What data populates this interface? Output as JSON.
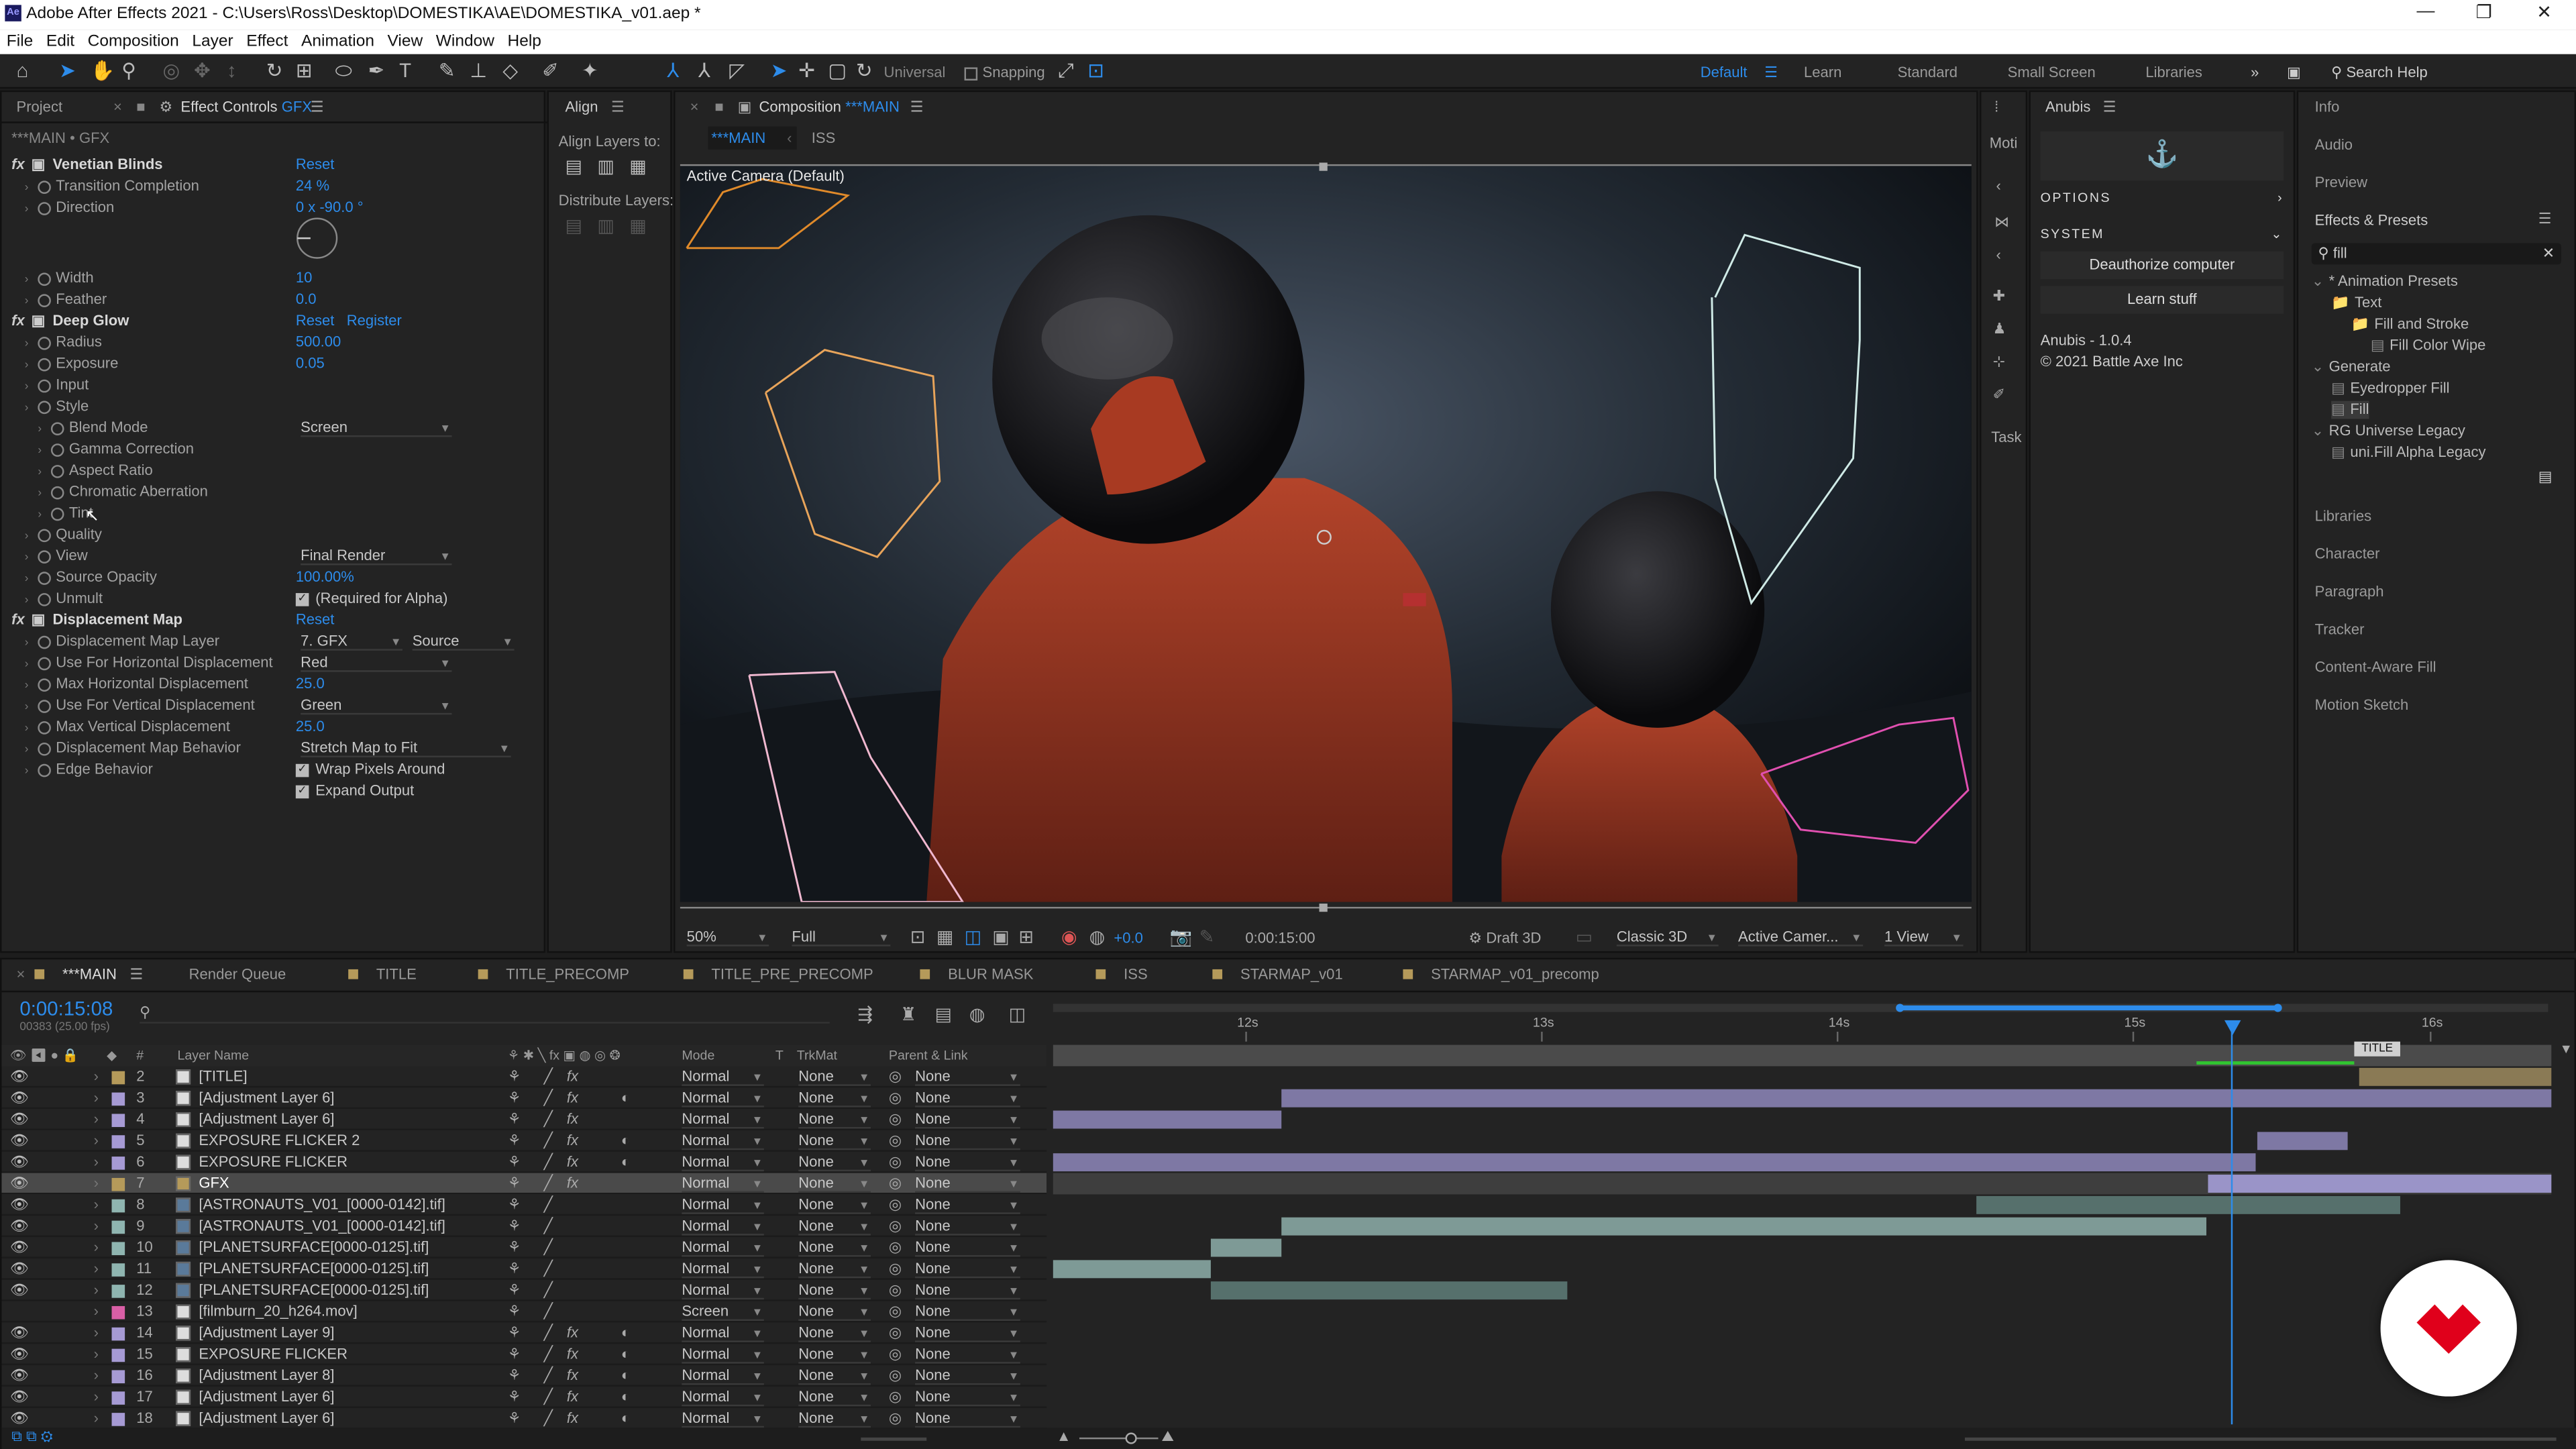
{
  "window": {
    "title": "Adobe After Effects 2021 - C:\\Users\\Ross\\Desktop\\DOMESTIKA\\AE\\DOMESTIKA_v01.aep *",
    "minimize": "—",
    "maximize": "❐",
    "close": "✕"
  },
  "menu": [
    "File",
    "Edit",
    "Composition",
    "Layer",
    "Effect",
    "Animation",
    "View",
    "Window",
    "Help"
  ],
  "toolbar": {
    "universal": "Universal",
    "snapping": "Snapping"
  },
  "workspaces": {
    "default": "Default",
    "learn": "Learn",
    "standard": "Standard",
    "small_screen": "Small Screen",
    "libraries": "Libraries",
    "search": "Search Help"
  },
  "left_panel": {
    "tab_project": "Project",
    "tab_effect_controls": "Effect Controls",
    "tab_layer": "GFX",
    "context": "***MAIN • GFX",
    "rows": [
      {
        "label": "Venetian Blinds",
        "value": "Reset",
        "bold": true,
        "fx": true
      },
      {
        "label": "Transition Completion",
        "value": "24 %"
      },
      {
        "label": "Direction",
        "value": "0 x -90.0 °"
      },
      {
        "label": "Width",
        "value": "10"
      },
      {
        "label": "Feather",
        "value": "0.0"
      },
      {
        "label": "Deep Glow",
        "value": "Reset",
        "extra": "Register",
        "bold": true,
        "fx": true
      },
      {
        "label": "Radius",
        "value": "500.00"
      },
      {
        "label": "Exposure",
        "value": "0.05"
      },
      {
        "label": "Input",
        "value": ""
      },
      {
        "label": "Style",
        "value": ""
      },
      {
        "label": "Blend Mode",
        "value": "Screen",
        "dropdown": true
      },
      {
        "label": "Gamma Correction",
        "value": ""
      },
      {
        "label": "Aspect Ratio",
        "value": ""
      },
      {
        "label": "Chromatic Aberration",
        "value": ""
      },
      {
        "label": "Tint",
        "value": ""
      },
      {
        "label": "Quality",
        "value": ""
      },
      {
        "label": "View",
        "value": "Final Render",
        "dropdown": true
      },
      {
        "label": "Source Opacity",
        "value": "100.00%"
      },
      {
        "label": "Unmult",
        "value": "(Required for Alpha)",
        "checkbox": true
      },
      {
        "label": "Displacement Map",
        "value": "Reset",
        "bold": true,
        "fx": true
      },
      {
        "label": "Displacement Map Layer",
        "value": "7. GFX",
        "value2": "Source",
        "dropdown": true
      },
      {
        "label": "Use For Horizontal Displacement",
        "value": "Red",
        "dropdown": true
      },
      {
        "label": "Max Horizontal Displacement",
        "value": "25.0"
      },
      {
        "label": "Use For Vertical Displacement",
        "value": "Green",
        "dropdown": true
      },
      {
        "label": "Max Vertical Displacement",
        "value": "25.0"
      },
      {
        "label": "Displacement Map Behavior",
        "value": "Stretch Map to Fit",
        "dropdown": true
      },
      {
        "label": "Edge Behavior",
        "value": "Wrap Pixels Around",
        "checkbox": true
      },
      {
        "label": "",
        "value": "Expand Output",
        "checkbox": true
      }
    ]
  },
  "align_panel": {
    "title": "Align",
    "align_to": "Align Layers to:",
    "distribute": "Distribute Layers:"
  },
  "comp_panel": {
    "title": "Composition",
    "comp_name": "***MAIN",
    "tab_main": "***MAIN",
    "tab_iss": "ISS",
    "camera": "Active Camera (Default)",
    "footer": {
      "zoom": "50%",
      "resolution": "Full",
      "exposure": "+0.0",
      "timecode": "0:00:15:00",
      "draft": "Draft 3D",
      "renderer": "Classic 3D",
      "camera": "Active Camer...",
      "views": "1 View"
    }
  },
  "side_tabs": [
    "Moti",
    "Task"
  ],
  "anubis": {
    "title": "Anubis",
    "options": "OPTIONS",
    "system": "SYSTEM",
    "deauth": "Deauthorize computer",
    "learn": "Learn stuff",
    "version": "Anubis - 1.0.4",
    "copyright": "© 2021 Battle Axe Inc"
  },
  "right_panel": {
    "top_items": [
      "Info",
      "Audio",
      "Preview",
      "Effects & Presets"
    ],
    "search": "fill",
    "tree": [
      {
        "label": "* Animation Presets",
        "level": 0
      },
      {
        "label": "Text",
        "level": 1
      },
      {
        "label": "Fill and Stroke",
        "level": 2
      },
      {
        "label": "Fill Color Wipe",
        "level": 3
      },
      {
        "label": "Generate",
        "level": 0
      },
      {
        "label": "Eyedropper Fill",
        "level": 1
      },
      {
        "label": "Fill",
        "level": 1,
        "selected": true
      },
      {
        "label": "RG Universe Legacy",
        "level": 0
      },
      {
        "label": "uni.Fill Alpha Legacy",
        "level": 1
      }
    ],
    "bottom_items": [
      "Libraries",
      "Character",
      "Paragraph",
      "Tracker",
      "Content-Aware Fill",
      "Motion Sketch"
    ]
  },
  "timeline": {
    "tabs": [
      "***MAIN",
      "Render Queue",
      "TITLE",
      "TITLE_PRECOMP",
      "TITLE_PRE_PRECOMP",
      "BLUR MASK",
      "ISS",
      "STARMAP_v01",
      "STARMAP_v01_precomp"
    ],
    "timecode": "0:00:15:08",
    "frames": "00383 (25.00 fps)",
    "headers": {
      "layer_name": "Layer Name",
      "mode": "Mode",
      "t": "T",
      "trkmat": "TrkMat",
      "parent": "Parent & Link",
      "hash": "#"
    },
    "ruler": [
      "12s",
      "13s",
      "14s",
      "15s",
      "16s"
    ],
    "title_marker": "TITLE",
    "layers": [
      {
        "num": "2",
        "name": "[TITLE]",
        "color": "#b59a5a",
        "mode": "Normal",
        "trk": "None",
        "parent": "None"
      },
      {
        "num": "3",
        "name": "[Adjustment Layer 6]",
        "color": "#a69ad4",
        "mode": "Normal",
        "trk": "None",
        "parent": "None"
      },
      {
        "num": "4",
        "name": "[Adjustment Layer 6]",
        "color": "#a69ad4",
        "mode": "Normal",
        "trk": "None",
        "parent": "None"
      },
      {
        "num": "5",
        "name": "EXPOSURE FLICKER 2",
        "color": "#a69ad4",
        "mode": "Normal",
        "trk": "None",
        "parent": "None"
      },
      {
        "num": "6",
        "name": "EXPOSURE FLICKER",
        "color": "#a69ad4",
        "mode": "Normal",
        "trk": "None",
        "parent": "None"
      },
      {
        "num": "7",
        "name": "GFX",
        "color": "#b59a5a",
        "mode": "Normal",
        "trk": "None",
        "parent": "None",
        "selected": true
      },
      {
        "num": "8",
        "name": "[ASTRONAUTS_V01_[0000-0142].tif]",
        "color": "#8fb5b0",
        "mode": "Normal",
        "trk": "None",
        "parent": "None"
      },
      {
        "num": "9",
        "name": "[ASTRONAUTS_V01_[0000-0142].tif]",
        "color": "#8fb5b0",
        "mode": "Normal",
        "trk": "None",
        "parent": "None"
      },
      {
        "num": "10",
        "name": "[PLANETSURFACE[0000-0125].tif]",
        "color": "#8fb5b0",
        "mode": "Normal",
        "trk": "None",
        "parent": "None"
      },
      {
        "num": "11",
        "name": "[PLANETSURFACE[0000-0125].tif]",
        "color": "#8fb5b0",
        "mode": "Normal",
        "trk": "None",
        "parent": "None"
      },
      {
        "num": "12",
        "name": "[PLANETSURFACE[0000-0125].tif]",
        "color": "#8fb5b0",
        "mode": "Normal",
        "trk": "None",
        "parent": "None"
      },
      {
        "num": "13",
        "name": "[filmburn_20_h264.mov]",
        "color": "#d95fa6",
        "mode": "Screen",
        "trk": "None",
        "parent": "None"
      },
      {
        "num": "14",
        "name": "[Adjustment Layer 9]",
        "color": "#a69ad4",
        "mode": "Normal",
        "trk": "None",
        "parent": "None"
      },
      {
        "num": "15",
        "name": "EXPOSURE FLICKER",
        "color": "#a69ad4",
        "mode": "Normal",
        "trk": "None",
        "parent": "None"
      },
      {
        "num": "16",
        "name": "[Adjustment Layer 8]",
        "color": "#a69ad4",
        "mode": "Normal",
        "trk": "None",
        "parent": "None"
      },
      {
        "num": "17",
        "name": "[Adjustment Layer 6]",
        "color": "#a69ad4",
        "mode": "Normal",
        "trk": "None",
        "parent": "None"
      },
      {
        "num": "18",
        "name": "[Adjustment Layer 6]",
        "color": "#a69ad4",
        "mode": "Normal",
        "trk": "None",
        "parent": "None"
      }
    ]
  },
  "colors": {
    "accent": "#2d8ceb",
    "brand_badge": "#e0001b"
  }
}
